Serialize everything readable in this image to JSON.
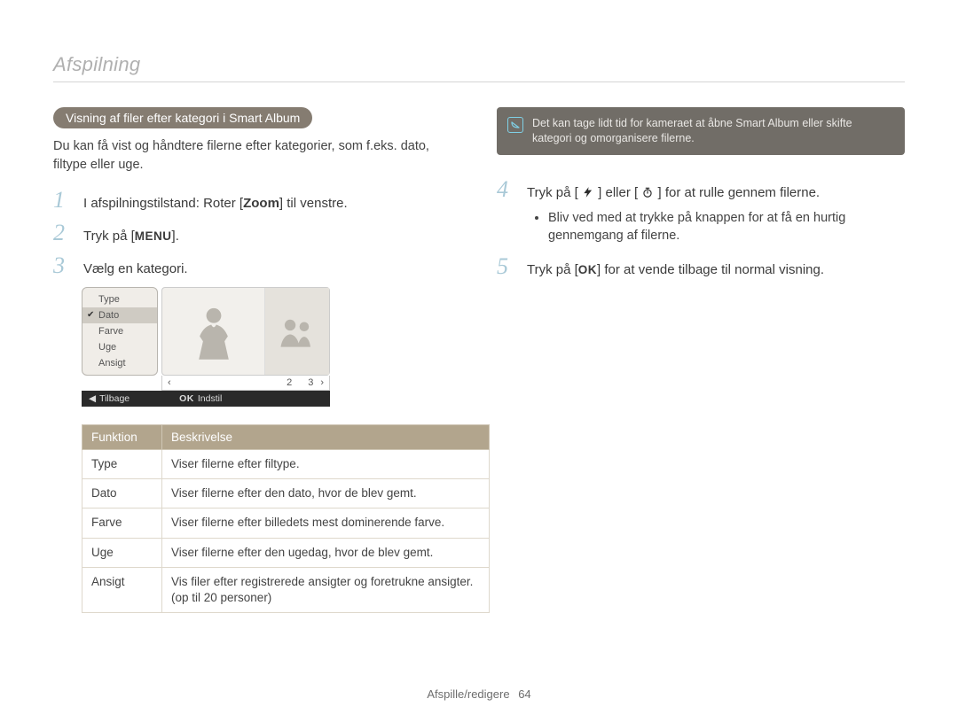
{
  "header": {
    "section_title": "Afspilning"
  },
  "left": {
    "pill_title": "Visning af filer efter kategori i Smart Album",
    "intro": "Du kan få vist og håndtere filerne efter kategorier, som f.eks. dato, filtype eller uge.",
    "steps": {
      "s1_pre": "I afspilningstilstand: Roter [",
      "s1_bold": "Zoom",
      "s1_post": "] til venstre.",
      "s2_pre": "Tryk på [",
      "s2_key": "MENU",
      "s2_post": "].",
      "s3": "Vælg en kategori."
    },
    "album_menu": [
      "Type",
      "Dato",
      "Farve",
      "Uge",
      "Ansigt"
    ],
    "album_selected_index": 1,
    "pager": {
      "left": "‹",
      "p2": "2",
      "p3": "3",
      "right": "›"
    },
    "bottom_bar": {
      "back_glyph": "◀",
      "back": "Tilbage",
      "ok_key": "OK",
      "set": "Indstil"
    },
    "table": {
      "headers": [
        "Funktion",
        "Beskrivelse"
      ],
      "rows": [
        [
          "Type",
          "Viser filerne efter filtype."
        ],
        [
          "Dato",
          "Viser filerne efter den dato, hvor de blev gemt."
        ],
        [
          "Farve",
          "Viser filerne efter billedets mest dominerende farve."
        ],
        [
          "Uge",
          "Viser filerne efter den ugedag, hvor de blev gemt."
        ],
        [
          "Ansigt",
          "Vis filer efter registrerede ansigter og foretrukne ansigter. (op til 20 personer)"
        ]
      ]
    }
  },
  "right": {
    "note": "Det kan tage lidt tid for kameraet at åbne Smart Album eller skifte kategori og omorganisere filerne.",
    "s4_pre": "Tryk på [",
    "s4_mid": "] eller [",
    "s4_post": "] for at rulle gennem filerne.",
    "s4_bullet": "Bliv ved med at trykke på knappen for at få en hurtig gennemgang af filerne.",
    "s5_pre": "Tryk på [",
    "s5_key": "OK",
    "s5_post": "] for at vende tilbage til normal visning."
  },
  "footer": {
    "section": "Afspille/redigere",
    "page": "64"
  }
}
